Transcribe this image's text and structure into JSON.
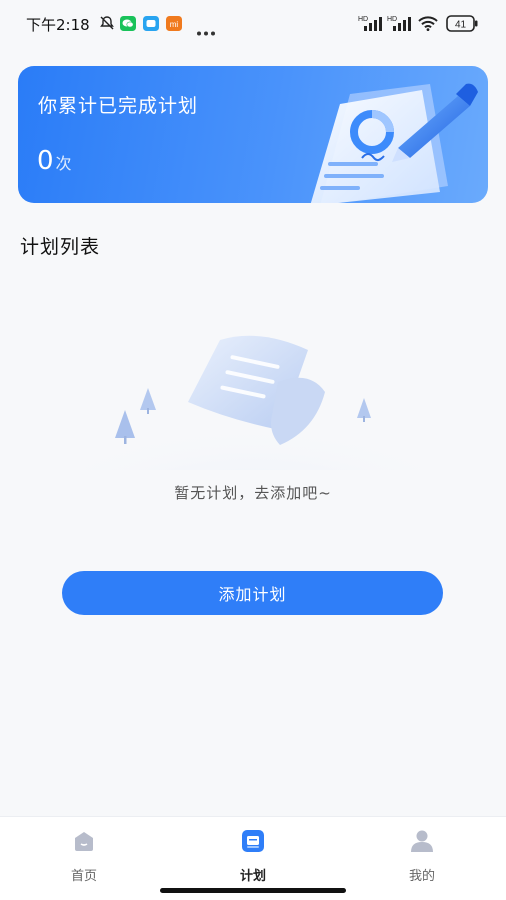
{
  "status_bar": {
    "time": "下午2:18",
    "battery": "41",
    "icons": [
      "mute-bell-icon",
      "wechat-icon",
      "message-app-icon",
      "mi-app-icon",
      "more-dots-icon",
      "hd-signal-icon",
      "hd-signal-icon",
      "wifi-icon",
      "battery-icon"
    ],
    "hd_label": "HD",
    "mi_label": "mi"
  },
  "banner": {
    "title": "你累计已完成计划",
    "count": "0",
    "count_unit": "次"
  },
  "section": {
    "title": "计划列表"
  },
  "empty_state": {
    "text": "暂无计划，去添加吧~"
  },
  "actions": {
    "add_plan_label": "添加计划"
  },
  "tab_bar": {
    "tabs": [
      {
        "label": "首页",
        "icon": "home-icon",
        "active": false
      },
      {
        "label": "计划",
        "icon": "plan-icon",
        "active": true
      },
      {
        "label": "我的",
        "icon": "profile-icon",
        "active": false
      }
    ]
  },
  "colors": {
    "accent": "#2f7ef8",
    "banner_gradient_start": "#2a7cf7",
    "banner_gradient_end": "#6aaafc",
    "background": "#f7f8fa"
  }
}
